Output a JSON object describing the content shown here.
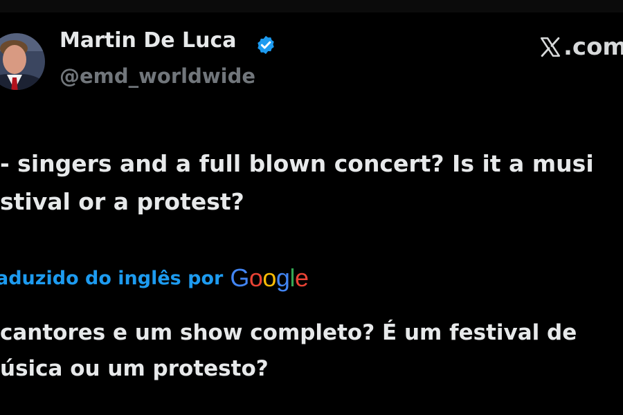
{
  "author": {
    "name": "Martin De Luca",
    "handle": "@emd_worldwide",
    "verified": true,
    "verified_color": "#1d9bf0"
  },
  "watermark": {
    "icon": "x-logo-icon",
    "text": ".com"
  },
  "tweet": {
    "lines": [
      "- singers and a full blown concert? Is it a musi",
      "stival or a protest?"
    ]
  },
  "translation": {
    "label": "aduzido do inglês por",
    "provider": "Google",
    "label_color": "#1d9bf0",
    "lines": [
      "cantores e um show completo? É um festival de",
      "úsica ou um protesto?"
    ]
  },
  "colors": {
    "background": "#000000",
    "text": "#e7e9ea",
    "secondary_text": "#71767b",
    "google_blue": "#4285f4",
    "google_red": "#ea4335",
    "google_yellow": "#fbbc05",
    "google_green": "#34a853"
  }
}
